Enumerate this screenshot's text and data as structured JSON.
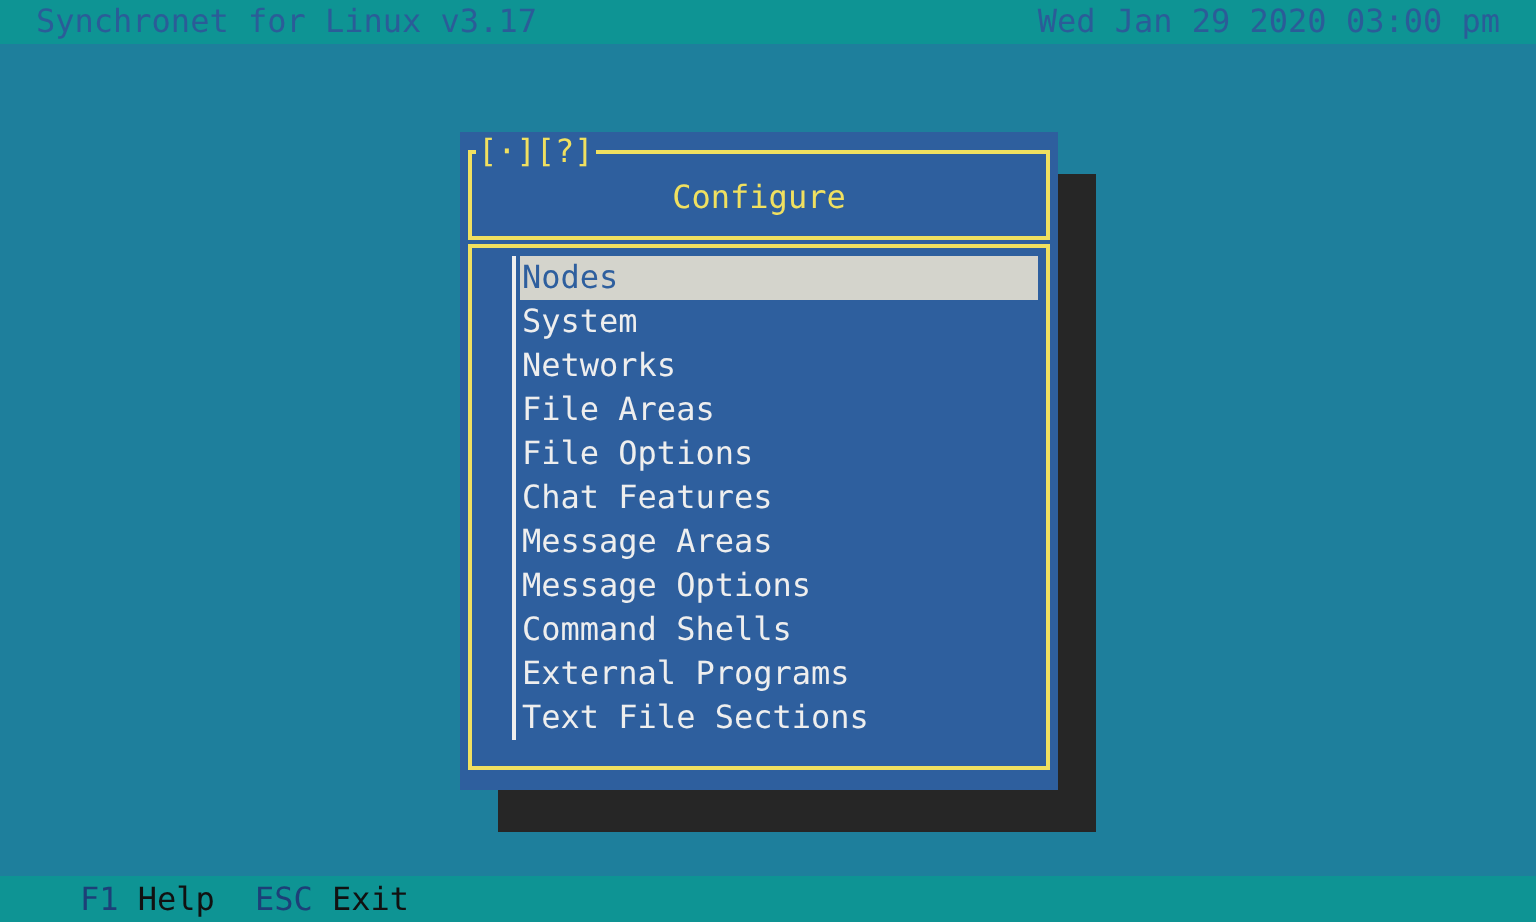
{
  "top_bar": {
    "title": "Synchronet for Linux v3.17",
    "datetime": "Wed Jan 29 2020 03:00 pm"
  },
  "dialog": {
    "buttons": [
      "[·]",
      "[?]"
    ],
    "title": "Configure",
    "items": [
      {
        "label": "Nodes",
        "selected": true
      },
      {
        "label": "System",
        "selected": false
      },
      {
        "label": "Networks",
        "selected": false
      },
      {
        "label": "File Areas",
        "selected": false
      },
      {
        "label": "File Options",
        "selected": false
      },
      {
        "label": "Chat Features",
        "selected": false
      },
      {
        "label": "Message Areas",
        "selected": false
      },
      {
        "label": "Message Options",
        "selected": false
      },
      {
        "label": "Command Shells",
        "selected": false
      },
      {
        "label": "External Programs",
        "selected": false
      },
      {
        "label": "Text File Sections",
        "selected": false
      }
    ]
  },
  "footer": [
    {
      "key": "F1",
      "label": "Help"
    },
    {
      "key": "ESC",
      "label": "Exit"
    }
  ]
}
